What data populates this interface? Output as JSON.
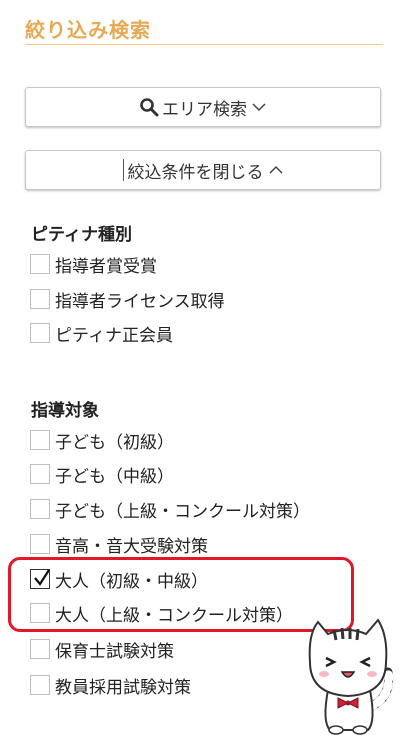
{
  "filter": {
    "title": "絞り込み検索",
    "search_button_label": "エリア検索",
    "close_button_label": "絞込条件を閉じる"
  },
  "sections": [
    {
      "heading": "ピティナ種別",
      "options": [
        {
          "label": "指導者賞受賞",
          "checked": false
        },
        {
          "label": "指導者ライセンス取得",
          "checked": false
        },
        {
          "label": "ピティナ正会員",
          "checked": false
        }
      ]
    },
    {
      "heading": "指導対象",
      "options": [
        {
          "label": "子ども（初級）",
          "checked": false
        },
        {
          "label": "子ども（中級）",
          "checked": false
        },
        {
          "label": "子ども（上級・コンクール対策）",
          "checked": false
        },
        {
          "label": "音高・音大受験対策",
          "checked": false
        },
        {
          "label": "大人（初級・中級）",
          "checked": true
        },
        {
          "label": "大人（上級・コンクール対策）",
          "checked": false
        },
        {
          "label": "保育士試験対策",
          "checked": false
        },
        {
          "label": "教員採用試験対策",
          "checked": false
        }
      ]
    }
  ],
  "colors": {
    "title": "#e8a955",
    "highlight": "#e0182a"
  },
  "icons": [
    "search-icon",
    "chevron-down-icon",
    "chevron-up-icon",
    "checkmark-icon",
    "cat-mascot-icon"
  ]
}
